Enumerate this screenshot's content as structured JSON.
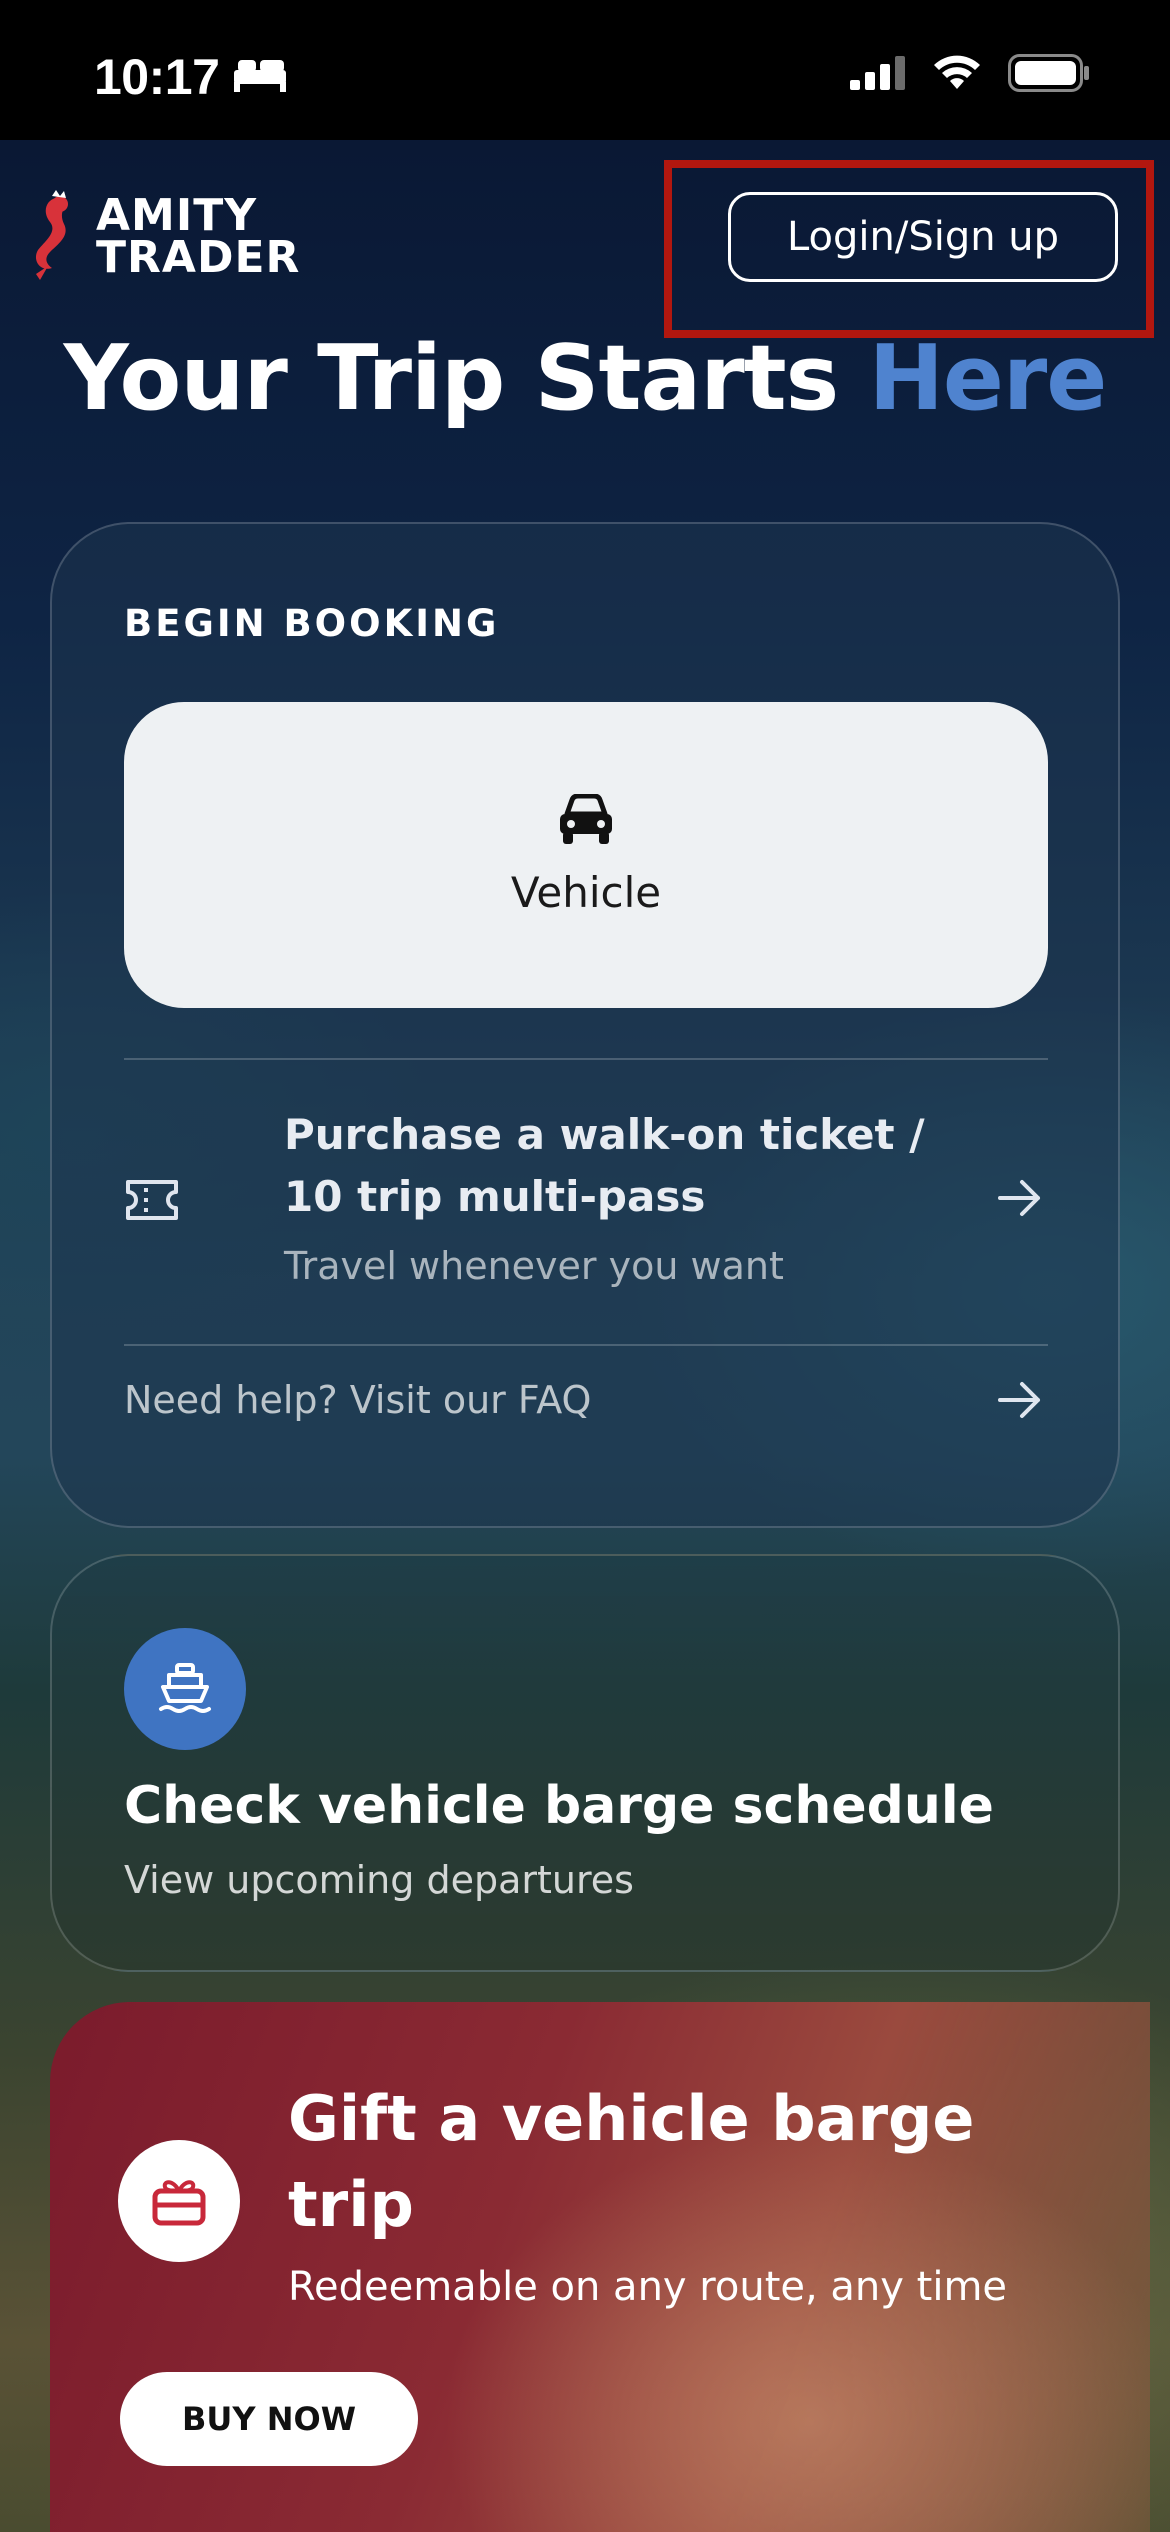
{
  "status_bar": {
    "time": "10:17",
    "icons": [
      "bed-icon",
      "signal-icon",
      "wifi-icon",
      "battery-icon"
    ]
  },
  "header": {
    "logo_line1": "AMITY",
    "logo_line2": "TRADER",
    "login_label": "Login/Sign up"
  },
  "hero": {
    "title_main": "Your Trip Starts ",
    "title_accent": "Here"
  },
  "booking": {
    "section_label": "BEGIN BOOKING",
    "vehicle_label": "Vehicle",
    "walkon_title": "Purchase a walk-on ticket / 10 trip multi-pass",
    "walkon_subtitle": "Travel whenever you want",
    "faq_text": "Need help? Visit our FAQ"
  },
  "schedule": {
    "title": "Check vehicle barge schedule",
    "subtitle": "View upcoming departures"
  },
  "gift": {
    "title": "Gift a vehicle barge trip",
    "subtitle": "Redeemable on any route, any time",
    "button_label": "BUY NOW"
  },
  "colors": {
    "accent_blue": "#4f83cf",
    "highlight_red": "#b2170f",
    "gift_red": "#7b1b2c"
  }
}
